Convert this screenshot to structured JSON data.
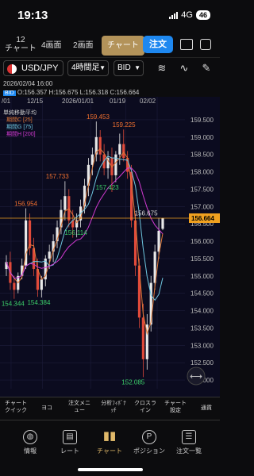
{
  "status": {
    "time": "19:13",
    "network": "4G",
    "battery": "46"
  },
  "tabs": {
    "tab1_count": "12",
    "tab1_label": "チャート",
    "tab2_label": "4画面",
    "tab3_label": "2画面",
    "tab4_label": "チャート",
    "order_label": "注文"
  },
  "symbol_bar": {
    "symbol": "USD/JPY",
    "timeframe": "4時間足",
    "price_type": "BID"
  },
  "info": {
    "datetime": "2026/02/04 16:00",
    "bid_tag": "BID",
    "ohlc": "O:156.357 H:156.675 L:156.318 C:156.664",
    "dates": [
      "/01",
      "12/15",
      "2026/01/01",
      "01/19",
      "02/02"
    ]
  },
  "legend": {
    "title": "単純移動平均",
    "items": [
      {
        "label": "期間C [25]",
        "color": "#e07a3a"
      },
      {
        "label": "期間G [75]",
        "color": "#6fc7e0"
      },
      {
        "label": "期間H [200]",
        "color": "#d13ad1"
      }
    ]
  },
  "chart_data": {
    "type": "candlestick",
    "yaxis_ticks": [
      "159.500",
      "159.000",
      "158.500",
      "158.000",
      "157.500",
      "157.000",
      "156.500",
      "156.000",
      "155.500",
      "155.000",
      "154.500",
      "154.000",
      "153.500",
      "153.000",
      "152.500",
      "152.000"
    ],
    "ylim": [
      151.75,
      159.75
    ],
    "current_price": 156.664,
    "current_price_label": "156.664",
    "annotations": [
      {
        "label": "159.453",
        "x": 0.53,
        "value": 159.453
      },
      {
        "label": "159.225",
        "x": 0.67,
        "value": 159.225
      },
      {
        "label": "157.733",
        "x": 0.31,
        "value": 157.733
      },
      {
        "label": "157.423",
        "x": 0.58,
        "value": 157.423
      },
      {
        "label": "156.954",
        "x": 0.14,
        "value": 156.954
      },
      {
        "label": "156.675",
        "x": 0.79,
        "value": 156.675
      },
      {
        "label": "156.114",
        "x": 0.41,
        "value": 156.114
      },
      {
        "label": "154.384",
        "x": 0.21,
        "value": 154.384
      },
      {
        "label": "154.344",
        "x": 0.07,
        "value": 154.344
      },
      {
        "label": "152.085",
        "x": 0.72,
        "value": 152.085
      }
    ],
    "candles": [
      [
        155.2,
        155.6,
        155.0,
        155.4
      ],
      [
        155.4,
        155.7,
        154.6,
        154.8
      ],
      [
        154.8,
        155.0,
        154.34,
        154.6
      ],
      [
        154.6,
        155.1,
        154.5,
        155.0
      ],
      [
        155.0,
        155.5,
        154.9,
        155.3
      ],
      [
        155.3,
        156.95,
        155.2,
        156.6
      ],
      [
        156.6,
        156.8,
        155.6,
        155.8
      ],
      [
        155.8,
        156.1,
        155.0,
        155.2
      ],
      [
        155.2,
        155.5,
        154.4,
        154.6
      ],
      [
        154.6,
        155.0,
        154.38,
        154.9
      ],
      [
        154.9,
        155.6,
        154.7,
        155.5
      ],
      [
        155.5,
        155.9,
        155.2,
        155.7
      ],
      [
        155.7,
        156.2,
        155.4,
        156.0
      ],
      [
        156.0,
        156.6,
        155.8,
        156.4
      ],
      [
        156.4,
        157.2,
        156.2,
        156.9
      ],
      [
        156.9,
        157.73,
        156.6,
        157.3
      ],
      [
        157.3,
        157.5,
        156.4,
        156.6
      ],
      [
        156.6,
        156.9,
        156.1,
        156.4
      ],
      [
        156.4,
        156.8,
        156.11,
        156.6
      ],
      [
        156.6,
        157.2,
        156.4,
        157.0
      ],
      [
        157.0,
        157.8,
        156.8,
        157.6
      ],
      [
        157.6,
        158.4,
        157.3,
        158.2
      ],
      [
        158.2,
        158.7,
        157.9,
        158.5
      ],
      [
        158.5,
        159.45,
        158.3,
        159.0
      ],
      [
        159.0,
        159.2,
        158.3,
        158.5
      ],
      [
        158.5,
        158.8,
        157.9,
        158.1
      ],
      [
        158.1,
        158.6,
        157.8,
        158.4
      ],
      [
        158.4,
        158.7,
        157.42,
        157.9
      ],
      [
        157.9,
        158.6,
        157.7,
        158.5
      ],
      [
        158.5,
        159.1,
        158.2,
        158.8
      ],
      [
        158.8,
        159.22,
        158.3,
        158.4
      ],
      [
        158.4,
        158.6,
        157.8,
        158.0
      ],
      [
        158.0,
        158.2,
        156.4,
        156.6
      ],
      [
        156.6,
        156.8,
        155.0,
        155.3
      ],
      [
        155.3,
        155.5,
        153.5,
        153.8
      ],
      [
        153.8,
        154.2,
        152.085,
        152.6
      ],
      [
        152.6,
        153.9,
        152.3,
        153.6
      ],
      [
        153.6,
        155.0,
        153.4,
        154.8
      ],
      [
        154.8,
        155.9,
        154.6,
        155.7
      ],
      [
        155.7,
        156.675,
        155.5,
        156.3
      ],
      [
        156.357,
        156.675,
        156.318,
        156.664
      ]
    ]
  },
  "bottom_bar": [
    "チャートクイック",
    "ヨコ",
    "注文メニュー",
    "分析ﾌｨﾎﾞﾅｯﾁ",
    "クロスライン",
    "チャート設定",
    "通貨"
  ],
  "nav": [
    "情報",
    "レート",
    "チャート",
    "ポジション",
    "注文一覧"
  ],
  "colors": {
    "up": "#e8e8e8",
    "down": "#e04a3a",
    "price_line": "#f0a020",
    "accent": "#e0b96a"
  }
}
